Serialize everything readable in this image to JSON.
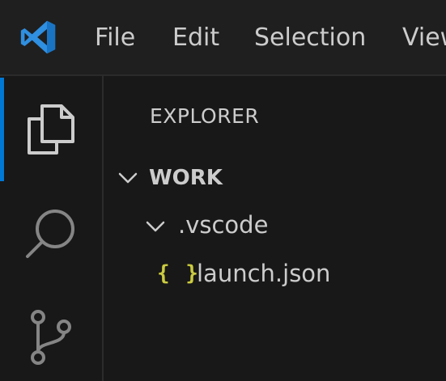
{
  "colors": {
    "accent": "#0078d4",
    "json_icon": "#cbcb41",
    "text": "#cccccc",
    "logo": "#2f8fe0"
  },
  "titlebar": {
    "logo_icon": "vscode-logo-icon",
    "menu": [
      {
        "label": "File"
      },
      {
        "label": "Edit"
      },
      {
        "label": "Selection"
      },
      {
        "label": "View"
      }
    ]
  },
  "activitybar": {
    "items": [
      {
        "icon": "explorer-files-icon",
        "active": true
      },
      {
        "icon": "search-icon",
        "active": false
      },
      {
        "icon": "source-control-icon",
        "active": false
      }
    ]
  },
  "sidebar": {
    "title": "EXPLORER",
    "tree": [
      {
        "label": "WORK",
        "type": "root-folder",
        "expanded": true
      },
      {
        "label": ".vscode",
        "type": "folder",
        "expanded": true
      },
      {
        "label": "launch.json",
        "type": "file",
        "file_icon": "{ }"
      }
    ]
  }
}
